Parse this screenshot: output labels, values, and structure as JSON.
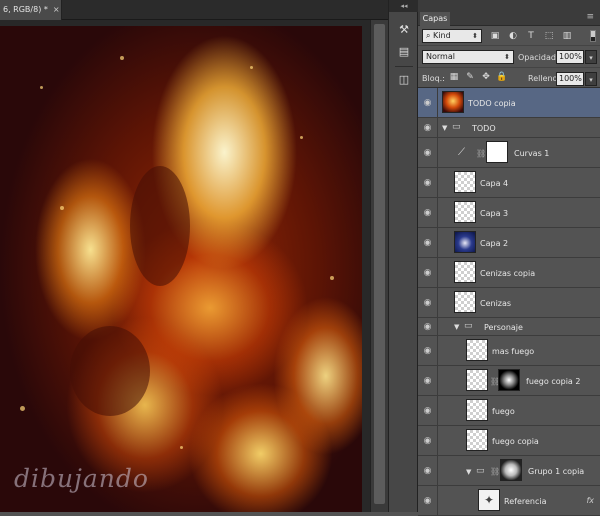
{
  "document": {
    "tab_title": "6, RGB/8) *",
    "close_glyph": "×",
    "watermark": "dibujando"
  },
  "toolstrip": {
    "collapse_glyph": "◂◂",
    "buttons": [
      {
        "icon": "adjust-brush-icon"
      },
      {
        "icon": "brush-presets-icon"
      },
      {
        "icon": "layers-panel-icon"
      }
    ]
  },
  "panel": {
    "tab_label": "Capas",
    "menu_glyph": "≡",
    "filter": {
      "value": "Kind",
      "icons": [
        "pixel-filter-icon",
        "adjustment-filter-icon",
        "type-filter-icon",
        "shape-filter-icon",
        "smart-object-filter-icon"
      ]
    },
    "blend_mode": "Normal",
    "opacity_label": "Opacidad:",
    "opacity_value": "100%",
    "lock_label": "Bloq.:",
    "fill_label": "Relleno:",
    "fill_value": "100%"
  },
  "layers": [
    {
      "name": "TODO copia",
      "type": "image",
      "thumb": "fire",
      "selected": true
    },
    {
      "name": "TODO",
      "type": "group",
      "expanded": true
    },
    {
      "name": "Curvas 1",
      "type": "adjustment",
      "mask": "white"
    },
    {
      "name": "Capa 4",
      "type": "transparent"
    },
    {
      "name": "Capa 3",
      "type": "transparent"
    },
    {
      "name": "Capa 2",
      "type": "image",
      "thumb": "blue"
    },
    {
      "name": "Cenizas copia",
      "type": "transparent"
    },
    {
      "name": "Cenizas",
      "type": "transparent"
    },
    {
      "name": "Personaje",
      "type": "group",
      "expanded": true
    },
    {
      "name": "mas fuego",
      "type": "transparent"
    },
    {
      "name": "fuego copia 2",
      "type": "transparent",
      "mask": "glow"
    },
    {
      "name": "fuego",
      "type": "transparent"
    },
    {
      "name": "fuego copia",
      "type": "transparent"
    },
    {
      "name": "Grupo 1 copia",
      "type": "group",
      "expanded": true,
      "mask": "figure"
    },
    {
      "name": "Referencia",
      "type": "image",
      "thumb": "sketch",
      "fx": "fx"
    }
  ],
  "colors": {
    "selected_row": "#576784",
    "panel_bg": "#535353"
  }
}
